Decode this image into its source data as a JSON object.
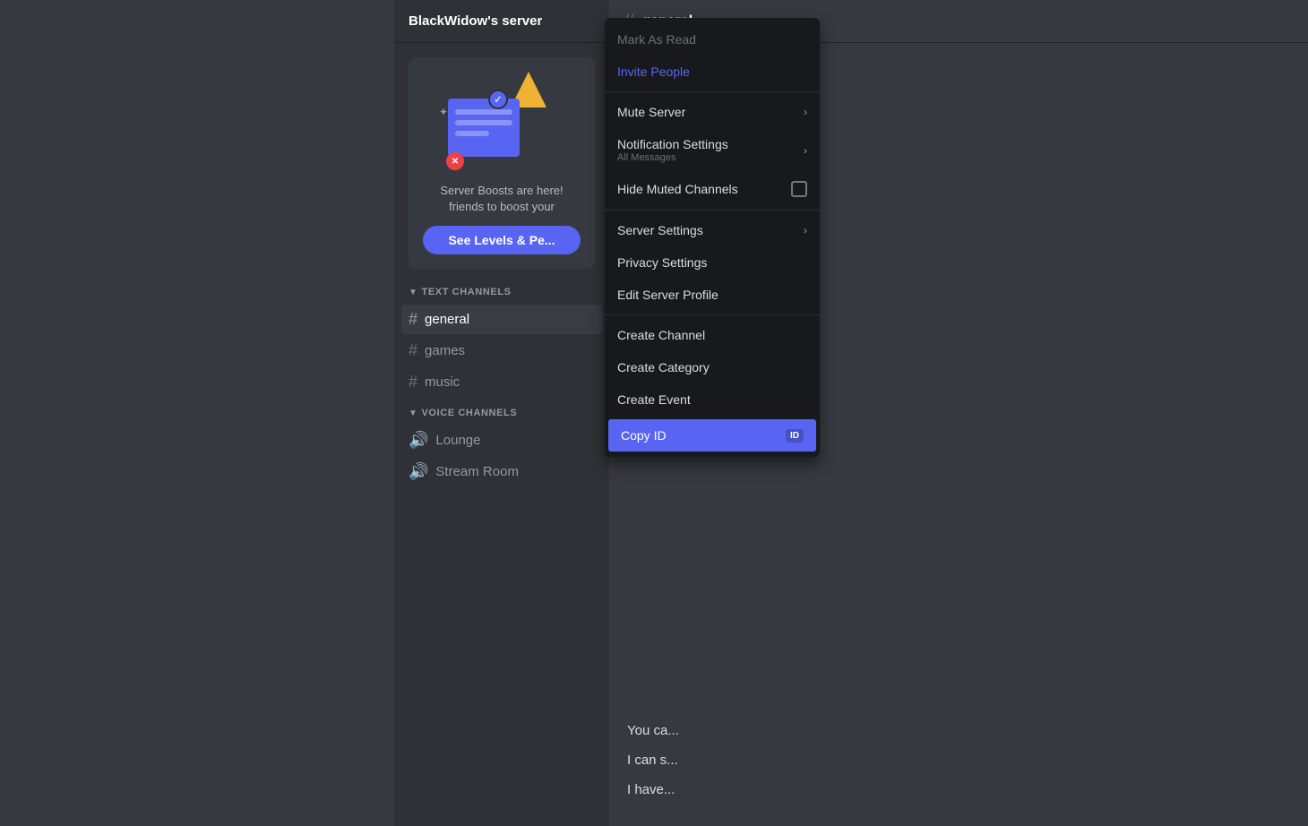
{
  "server": {
    "name": "BlackWidow's server"
  },
  "boost_banner": {
    "text_line1": "Server Boosts are here!",
    "text_line2": "friends to boost your",
    "button_label": "See Levels & Pe..."
  },
  "channels": {
    "text_section_label": "TEXT CHANNELS",
    "voice_section_label": "VOICE CHANNELS",
    "text_channels": [
      {
        "name": "general",
        "active": true
      },
      {
        "name": "games",
        "active": false
      },
      {
        "name": "music",
        "active": false
      }
    ],
    "voice_channels": [
      {
        "name": "Lounge"
      },
      {
        "name": "Stream Room"
      }
    ]
  },
  "chat": {
    "channel_name": "general",
    "messages": [
      {
        "text": "You ca..."
      },
      {
        "text": "I can s..."
      },
      {
        "text": "I have..."
      }
    ]
  },
  "context_menu": {
    "items": [
      {
        "id": "mark-as-read",
        "label": "Mark As Read",
        "type": "normal",
        "muted": true
      },
      {
        "id": "invite-people",
        "label": "Invite People",
        "type": "highlight"
      },
      {
        "id": "mute-server",
        "label": "Mute Server",
        "type": "normal",
        "arrow": true
      },
      {
        "id": "notification-settings",
        "label": "Notification Settings",
        "sublabel": "All Messages",
        "type": "normal",
        "arrow": true
      },
      {
        "id": "hide-muted-channels",
        "label": "Hide Muted Channels",
        "type": "checkbox"
      },
      {
        "id": "server-settings",
        "label": "Server Settings",
        "type": "normal",
        "arrow": true
      },
      {
        "id": "privacy-settings",
        "label": "Privacy Settings",
        "type": "normal"
      },
      {
        "id": "edit-server-profile",
        "label": "Edit Server Profile",
        "type": "normal"
      },
      {
        "id": "create-channel",
        "label": "Create Channel",
        "type": "normal"
      },
      {
        "id": "create-category",
        "label": "Create Category",
        "type": "normal"
      },
      {
        "id": "create-event",
        "label": "Create Event",
        "type": "normal"
      },
      {
        "id": "copy-id",
        "label": "Copy ID",
        "type": "copy-id",
        "badge": "ID"
      }
    ]
  }
}
